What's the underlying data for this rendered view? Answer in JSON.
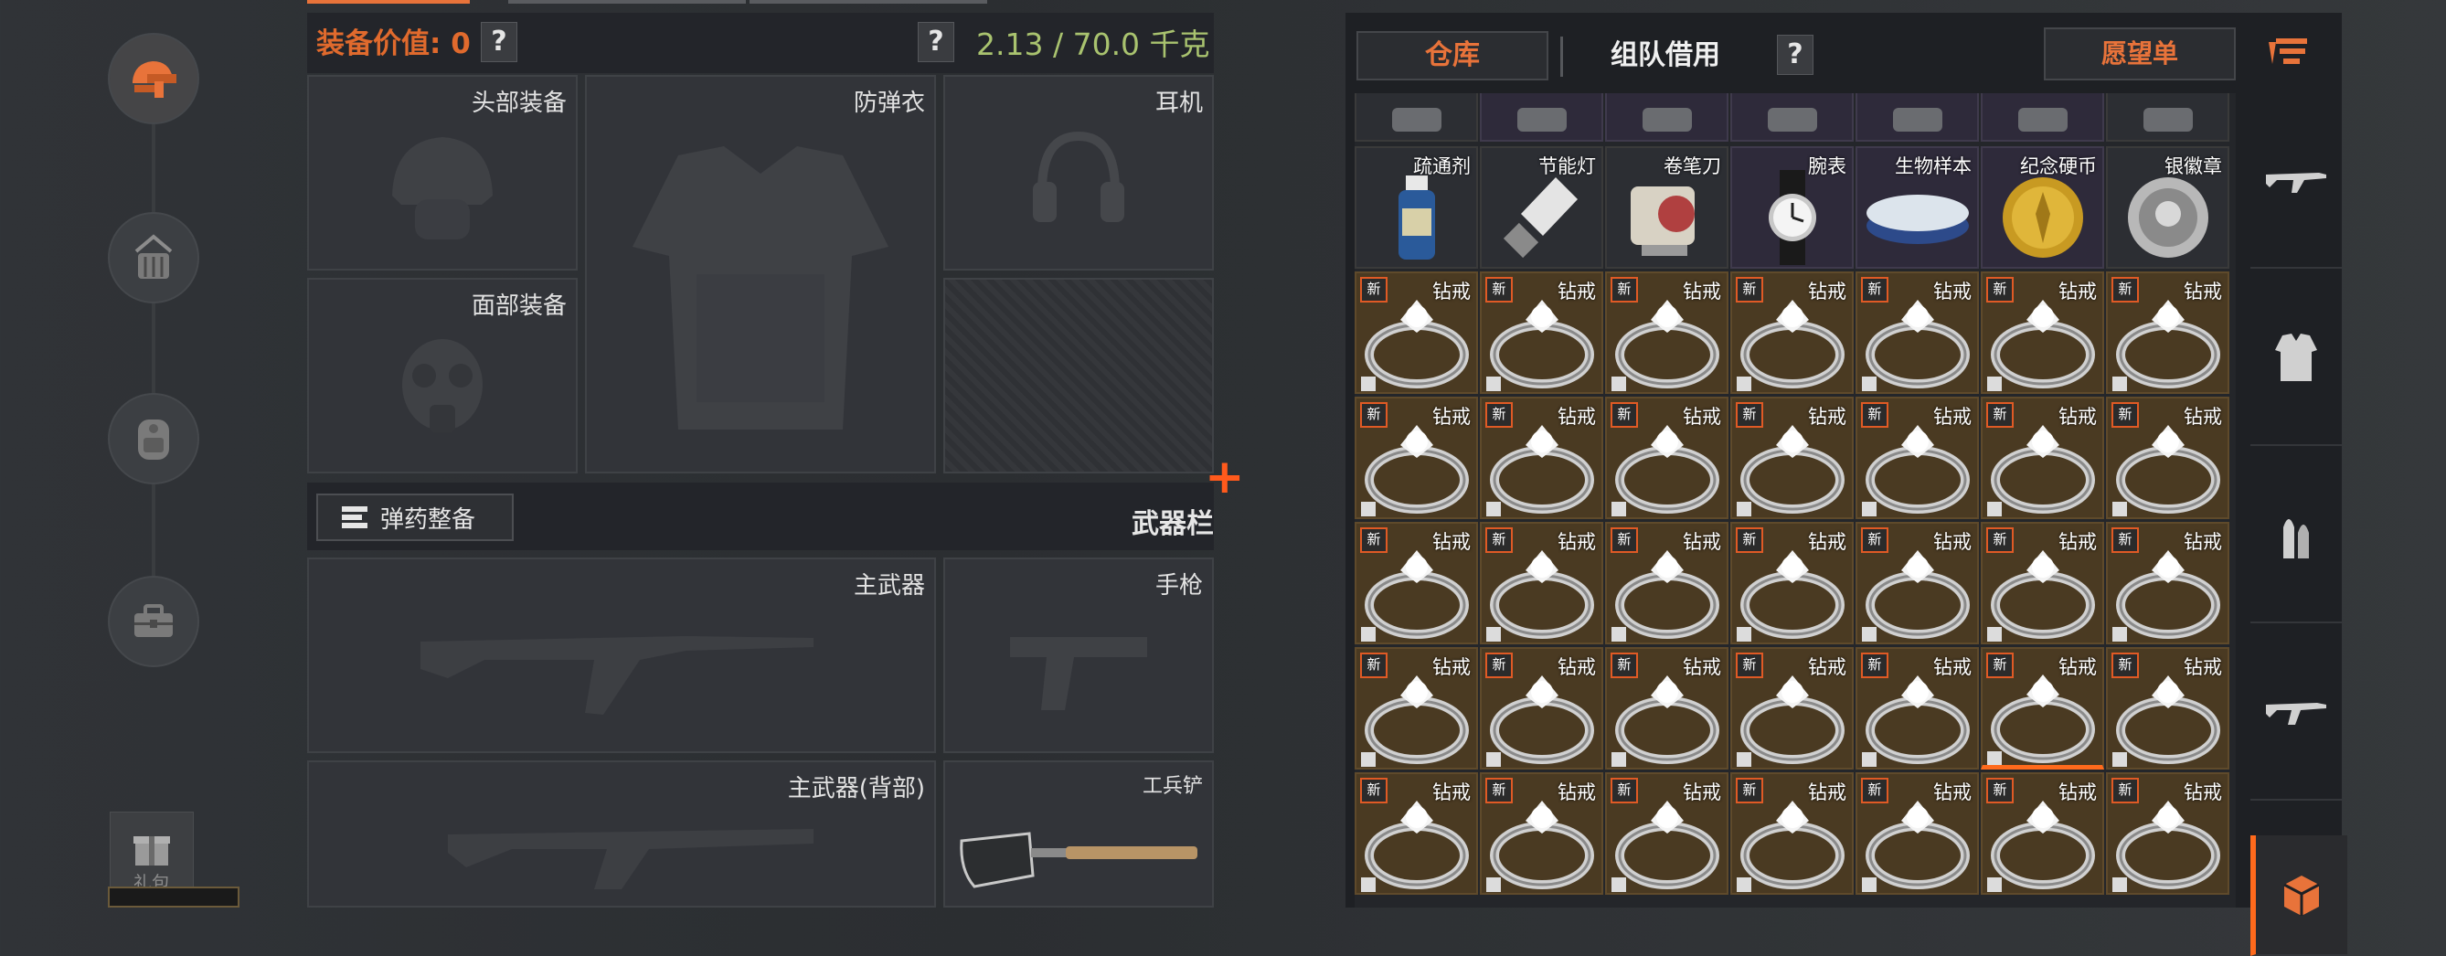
{
  "colors": {
    "accent": "#e8733a",
    "weight": "#a9c36f",
    "new_badge": "#e05a25",
    "selection": "#ff6a1c"
  },
  "left_nav": {
    "items": [
      {
        "icon": "helmet-gun-icon",
        "active": true
      },
      {
        "icon": "backpack-gear-icon",
        "active": false
      },
      {
        "icon": "backpack-icon",
        "active": false
      },
      {
        "icon": "toolbox-icon",
        "active": false
      }
    ],
    "gift_label": "礼包"
  },
  "loadout": {
    "value_label": "装备价值: 0",
    "help_mark": "?",
    "weight": "2.13 / 70.0 千克",
    "slots": {
      "head": "头部装备",
      "armor": "防弹衣",
      "headset": "耳机",
      "face": "面部装备"
    },
    "ammo_button": "弹药整备",
    "weapons_label": "武器栏",
    "weapon_slots": {
      "primary": "主武器",
      "pistol": "手枪",
      "primary_back": "主武器(背部)",
      "melee": "工兵铲"
    },
    "plus_icon": "+"
  },
  "storage": {
    "tab_storage": "仓库",
    "tab_team": "组队借用",
    "help_mark": "?",
    "tab_wishlist": "愿望单",
    "row_top_partial": [
      {
        "bg": "plain"
      },
      {
        "bg": "purple"
      },
      {
        "bg": "purple"
      },
      {
        "bg": "purple"
      },
      {
        "bg": "purple"
      },
      {
        "bg": "purple"
      },
      {
        "bg": "plain"
      }
    ],
    "row_items": [
      {
        "name": "疏通剂",
        "bg": "plain",
        "icon": "bottle-icon"
      },
      {
        "name": "节能灯",
        "bg": "plain",
        "icon": "bulb-icon"
      },
      {
        "name": "卷笔刀",
        "bg": "plain",
        "icon": "sharpener-icon"
      },
      {
        "name": "腕表",
        "bg": "purple",
        "icon": "watch-icon"
      },
      {
        "name": "生物样本",
        "bg": "purple",
        "icon": "sample-dish-icon"
      },
      {
        "name": "纪念硬币",
        "bg": "purple",
        "icon": "gold-coin-icon"
      },
      {
        "name": "银徽章",
        "bg": "plain",
        "icon": "silver-badge-icon"
      }
    ],
    "ring_name": "钻戒",
    "new_badge": "新",
    "ring_rows": 5,
    "ring_cols": 7,
    "selected_cell": {
      "row": 3,
      "col": 5
    }
  },
  "filters": [
    {
      "icon": "rifle-icon"
    },
    {
      "icon": "armor-vest-icon"
    },
    {
      "icon": "ammo-icon"
    },
    {
      "icon": "assault-rifle-icon"
    },
    {
      "icon": "box-icon"
    }
  ]
}
